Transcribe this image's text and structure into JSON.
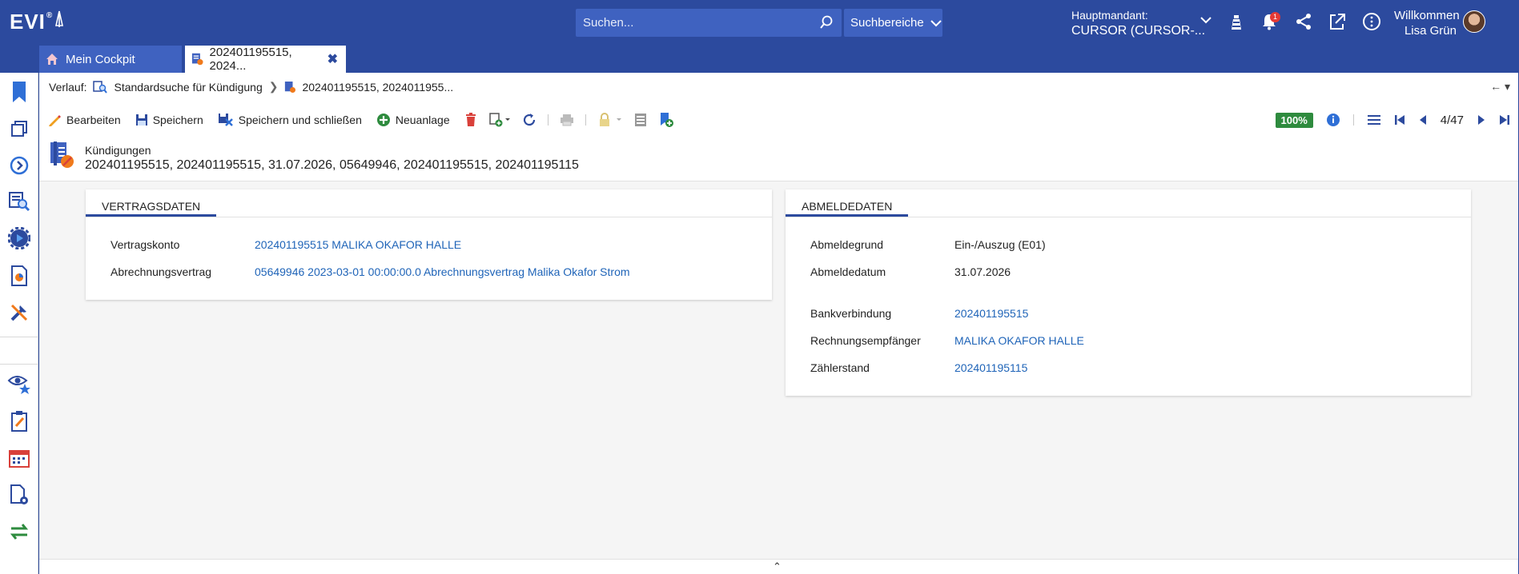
{
  "app": {
    "logo": "EVI",
    "logo_mark": "®",
    "search_placeholder": "Suchen...",
    "search_scope": "Suchbereiche",
    "mandant_label": "Hauptmandant:",
    "mandant_value": "CURSOR (CURSOR-...",
    "notification_count": "1",
    "welcome_label": "Willkommen",
    "user_name": "Lisa Grün"
  },
  "tabs": [
    {
      "label": "Mein Cockpit"
    },
    {
      "label": "202401195515, 2024..."
    }
  ],
  "breadcrumb": {
    "prefix": "Verlauf:",
    "items": [
      "Standardsuche für Kündigung",
      "202401195515, 2024011955..."
    ]
  },
  "toolbar": {
    "edit": "Bearbeiten",
    "save": "Speichern",
    "save_close": "Speichern und schließen",
    "new": "Neuanlage",
    "completeness": "100%",
    "record_position": "4/47"
  },
  "record": {
    "type": "Kündigungen",
    "title": "202401195515, 202401195515, 31.07.2026, 05649946, 202401195515, 202401195115"
  },
  "vertragsdaten": {
    "tab": "VERTRAGSDATEN",
    "rows": [
      {
        "label": "Vertragskonto",
        "value": "202401195515 MALIKA OKAFOR HALLE"
      },
      {
        "label": "Abrechnungsvertrag",
        "value": "05649946 2023-03-01 00:00:00.0 Abrechnungsvertrag Malika Okafor Strom"
      }
    ]
  },
  "abmeldedaten": {
    "tab": "ABMELDEDATEN",
    "rows": [
      {
        "label": "Abmeldegrund",
        "value": "Ein-/Auszug (E01)"
      },
      {
        "label": "Abmeldedatum",
        "value": "31.07.2026"
      },
      {
        "label": "Bankverbindung",
        "value": "202401195515"
      },
      {
        "label": "Rechnungsempfänger",
        "value": "MALIKA OKAFOR HALLE"
      },
      {
        "label": "Zählerstand",
        "value": "202401195115"
      }
    ]
  },
  "colors": {
    "brand": "#2c4a9e",
    "link": "#1f64b8",
    "success": "#2e8b3e"
  }
}
